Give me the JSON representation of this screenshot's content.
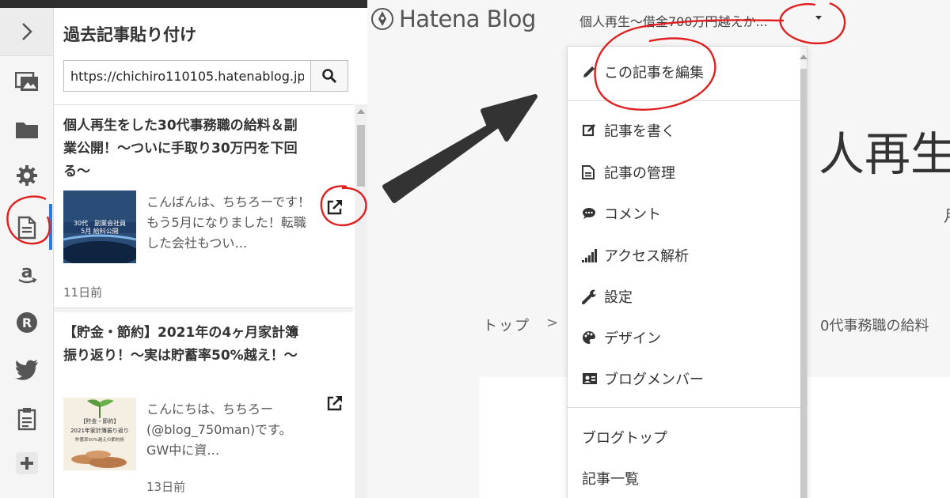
{
  "left_panel": {
    "title": "過去記事貼り付け",
    "url_input": {
      "value": "https://chichiro110105.hatenablog.jp/",
      "placeholder": ""
    },
    "rail_icons": [
      "chevron-right-icon",
      "image-icon",
      "folder-icon",
      "gear-icon",
      "document-icon",
      "amazon-icon",
      "rakuten-icon",
      "twitter-icon",
      "clipboard-icon",
      "plus-icon"
    ],
    "entries": [
      {
        "title": "個人再生をした30代事務職の給料＆副業公開！〜ついに手取り30万円を下回る〜",
        "excerpt": "こんばんは、ちちろーです！もう5月になりました！転職した会社もつい…",
        "date": "11日前",
        "thumb_lines": [
          "30代　副業会社員",
          "5月 給料公開"
        ]
      },
      {
        "title": "【貯金・節約】2021年の4ヶ月家計簿振り返り！〜実は貯蓄率50%越え！〜",
        "excerpt": "こんにちは、ちちろー(@blog_750man)です。 GW中に資…",
        "date": "13日前",
        "thumb_lines": [
          "【貯金・節約】",
          "2021年家計簿振り返り",
          "貯蓄率50%越えの節約術"
        ]
      }
    ]
  },
  "right_area": {
    "logo_text": "Hatena Blog",
    "blog_name": "個人再生〜借金700万円越えか...",
    "bg_title": "人再生〜",
    "bg_right_char": "月",
    "breadcrumb_top": "トップ",
    "breadcrumb_sep": ">",
    "breadcrumb_rest": "0代事務職の給料",
    "dropdown": {
      "items": [
        {
          "label": "この記事を編集",
          "icon": "pencil-icon"
        },
        {
          "label": "記事を書く",
          "icon": "edit-square-icon"
        },
        {
          "label": "記事の管理",
          "icon": "document-icon"
        },
        {
          "label": "コメント",
          "icon": "comment-icon"
        },
        {
          "label": "アクセス解析",
          "icon": "signal-bars-icon"
        },
        {
          "label": "設定",
          "icon": "wrench-icon"
        },
        {
          "label": "デザイン",
          "icon": "palette-icon"
        },
        {
          "label": "ブログメンバー",
          "icon": "id-card-icon"
        },
        {
          "label": "ブログトップ",
          "icon": ""
        },
        {
          "label": "記事一覧",
          "icon": ""
        }
      ]
    }
  },
  "colors": {
    "annotation_red": "#e02020",
    "arrow": "#333333",
    "active_rail": "#2a7ae2"
  }
}
